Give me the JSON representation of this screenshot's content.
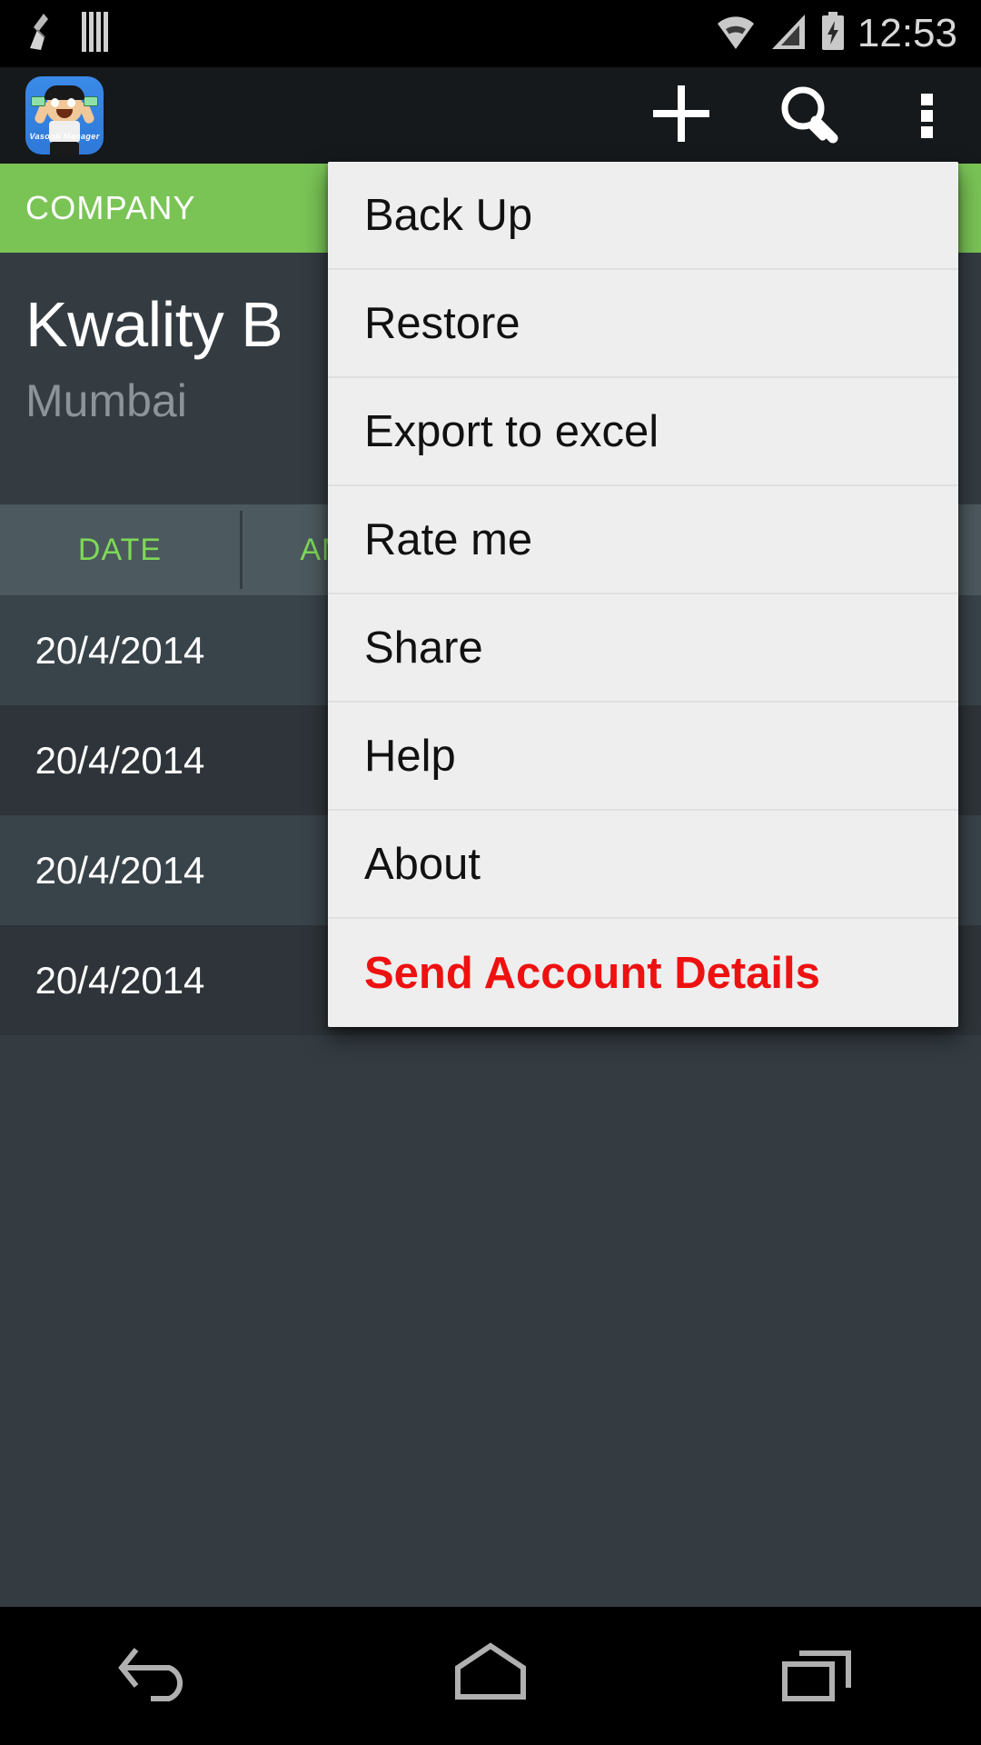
{
  "status_bar": {
    "time": "12:53",
    "icons": [
      "broom-icon",
      "barcode-icon",
      "wifi-icon",
      "signal-icon",
      "battery-charging-icon"
    ]
  },
  "action_bar": {
    "app_logo_label": "Vasooli Manager",
    "actions": [
      {
        "name": "add-icon",
        "label": "+"
      },
      {
        "name": "search-icon",
        "label": "Search"
      },
      {
        "name": "overflow-menu-icon",
        "label": "More options"
      }
    ]
  },
  "tabs": [
    {
      "label": "COMPANY",
      "selected": true
    }
  ],
  "company": {
    "name": "Kwality B",
    "city": "Mumbai"
  },
  "table": {
    "columns": [
      "DATE",
      "AMOUNT"
    ],
    "rows": [
      {
        "date": "20/4/2014"
      },
      {
        "date": "20/4/2014"
      },
      {
        "date": "20/4/2014"
      },
      {
        "date": "20/4/2014"
      }
    ]
  },
  "overflow_menu": {
    "items": [
      {
        "label": "Back Up",
        "style": "normal"
      },
      {
        "label": "Restore",
        "style": "normal"
      },
      {
        "label": "Export to excel",
        "style": "normal"
      },
      {
        "label": "Rate me",
        "style": "normal"
      },
      {
        "label": "Share",
        "style": "normal"
      },
      {
        "label": "Help",
        "style": "normal"
      },
      {
        "label": "About",
        "style": "normal"
      },
      {
        "label": "Send Account Details",
        "style": "danger"
      }
    ]
  },
  "nav_bar": {
    "buttons": [
      {
        "name": "back-icon",
        "label": "Back"
      },
      {
        "name": "home-icon",
        "label": "Home"
      },
      {
        "name": "recents-icon",
        "label": "Recents"
      }
    ]
  },
  "colors": {
    "accent_green": "#7ac456",
    "header_green_text": "#7ed957",
    "danger_red": "#ee1111",
    "body_bg": "#343c42",
    "menu_bg": "#eeeeee"
  }
}
